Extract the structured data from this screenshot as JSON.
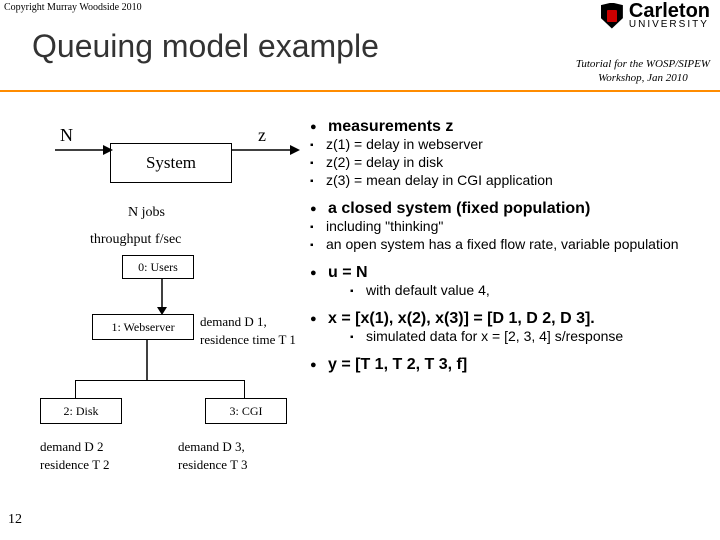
{
  "copyright": "Copyright Murray Woodside 2010",
  "title": "Queuing model example",
  "tagline1": "Tutorial for the WOSP/SIPEW",
  "tagline2": "Workshop, Jan 2010",
  "logo": {
    "name": "Carleton",
    "sub": "UNIVERSITY"
  },
  "diagram": {
    "N": "N",
    "z": "z",
    "system": "System",
    "njobs": "N jobs",
    "throughput": "throughput f/sec",
    "users": "0: Users",
    "web": "1: Webserver",
    "d1": "demand D 1,\nresidence time T 1",
    "disk": "2: Disk",
    "cgi": "3: CGI",
    "d2": "demand D 2\nresidence T 2",
    "d3": "demand D 3,\nresidence T 3"
  },
  "bullets": {
    "b1": {
      "head": "measurements z",
      "sub": [
        "z(1) = delay in webserver",
        "z(2) = delay in disk",
        "z(3) = mean delay in CGI application"
      ]
    },
    "b2": {
      "head": "a closed system (fixed population)",
      "sub": [
        "including \"thinking\"",
        "an open system has a fixed flow rate, variable population"
      ]
    },
    "b3": {
      "head": "u = N",
      "sub": [
        "with default value 4,"
      ]
    },
    "b4": {
      "head": "x = [x(1), x(2), x(3)] = [D 1, D 2, D 3].",
      "sub": [
        "simulated data for x = [2, 3, 4] s/response"
      ]
    },
    "b5": {
      "head": "y =  [T 1, T 2, T 3, f]"
    }
  },
  "slide_number": "12"
}
